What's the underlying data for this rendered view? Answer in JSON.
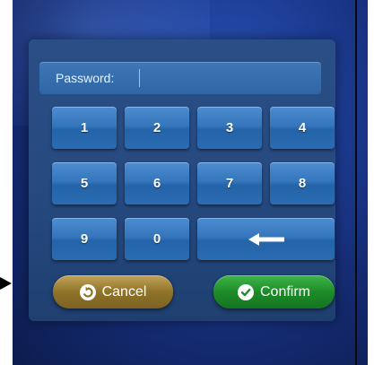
{
  "password": {
    "label": "Password:",
    "value": ""
  },
  "keypad": {
    "keys": [
      {
        "label": "1"
      },
      {
        "label": "2"
      },
      {
        "label": "3"
      },
      {
        "label": "4"
      },
      {
        "label": "5"
      },
      {
        "label": "6"
      },
      {
        "label": "7"
      },
      {
        "label": "8"
      },
      {
        "label": "9"
      },
      {
        "label": "0"
      }
    ],
    "backspace_icon": "left-arrow-icon"
  },
  "actions": {
    "cancel_label": "Cancel",
    "cancel_icon": "undo-icon",
    "confirm_label": "Confirm",
    "confirm_icon": "checkmark-icon"
  },
  "colors": {
    "cancel": "#8f7329",
    "confirm": "#1d8c28",
    "key": "#3575bc"
  }
}
